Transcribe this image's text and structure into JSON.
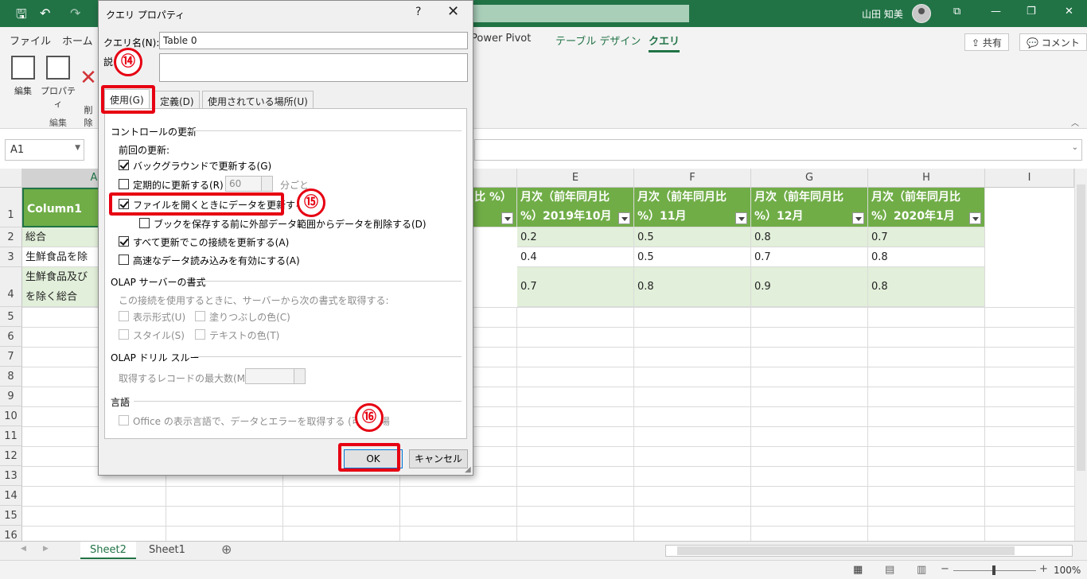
{
  "titlebar": {
    "user": "山田 知美",
    "buttons": [
      "⧉",
      "—",
      "❐",
      "✕"
    ]
  },
  "ribbon": {
    "tabs": [
      {
        "label": "ファイル"
      },
      {
        "label": "ホーム"
      },
      {
        "label": "Power Pivot"
      },
      {
        "label": "テーブル デザイン"
      },
      {
        "label": "クエリ"
      }
    ],
    "share": "共有",
    "comment": "コメント",
    "buttons": [
      {
        "label": "編集"
      },
      {
        "label": "プロパティ"
      },
      {
        "label": "削\n除"
      }
    ],
    "group_label": "編集"
  },
  "formula": {
    "namebox": "A1"
  },
  "grid": {
    "columns": [
      "A",
      "",
      "",
      "",
      "E",
      "F",
      "G",
      "H",
      "I"
    ],
    "rows": [
      "1",
      "2",
      "3",
      "4",
      "5",
      "6",
      "7",
      "8",
      "9",
      "10",
      "11",
      "12",
      "13",
      "14",
      "15",
      "16"
    ],
    "header_a": "Column1",
    "header_d_fragment": "比 %）",
    "headers": [
      {
        "line1": "月次（前年同月比",
        "line2": "%）2019年10月"
      },
      {
        "line1": "月次（前年同月比",
        "line2": "%）11月"
      },
      {
        "line1": "月次（前年同月比",
        "line2": "%）12月"
      },
      {
        "line1": "月次（前年同月比",
        "line2": "%）2020年1月"
      }
    ],
    "row_labels": [
      "総合",
      "生鮮食品を除",
      "生鮮食品及び",
      "を除く総合"
    ],
    "data": [
      [
        "0.2",
        "0.5",
        "0.8",
        "0.7"
      ],
      [
        "0.4",
        "0.5",
        "0.7",
        "0.8"
      ],
      [
        "0.7",
        "0.8",
        "0.9",
        "0.8"
      ]
    ]
  },
  "sheets": [
    {
      "label": "Sheet2",
      "active": true
    },
    {
      "label": "Sheet1",
      "active": false
    }
  ],
  "status": {
    "zoom": "100%"
  },
  "dialog": {
    "title": "クエリ プロパティ",
    "help": "?",
    "close": "✕",
    "name_label": "クエリ名(N):",
    "name_value": "Table 0",
    "desc_label": "説",
    "tabs": [
      "使用(G)",
      "定義(D)",
      "使用されている場所(U)"
    ],
    "section_refresh": "コントロールの更新",
    "last_refresh": "前回の更新:",
    "opt_background": "バックグラウンドで更新する(G)",
    "opt_periodic": "定期的に更新する(R)",
    "periodic_value": "60",
    "periodic_unit": "分ごと",
    "opt_open": "ファイルを開くときにデータを更新する(O)",
    "opt_remove": "ブックを保存する前に外部データ範囲からデータを削除する(D)",
    "opt_refresh_all": "すべて更新でこの接続を更新する(A)",
    "opt_fast_load": "高速なデータ読み込みを有効にする(A)",
    "section_olap": "OLAP サーバーの書式",
    "olap_desc": "この接続を使用するときに、サーバーから次の書式を取得する:",
    "olap_number": "表示形式(U)",
    "olap_fill": "塗りつぶしの色(C)",
    "olap_style": "スタイル(S)",
    "olap_text": "テキストの色(T)",
    "section_drill": "OLAP ドリル スルー",
    "drill_label": "取得するレコードの最大数(M):",
    "section_lang": "言語",
    "lang_option": "Office の表示言語で、データとエラーを取得する (可能な場",
    "ok": "OK",
    "cancel": "キャンセル"
  },
  "annotations": {
    "b14": "⑭",
    "b15": "⑮",
    "b16": "⑯",
    "color": "#e60012"
  }
}
